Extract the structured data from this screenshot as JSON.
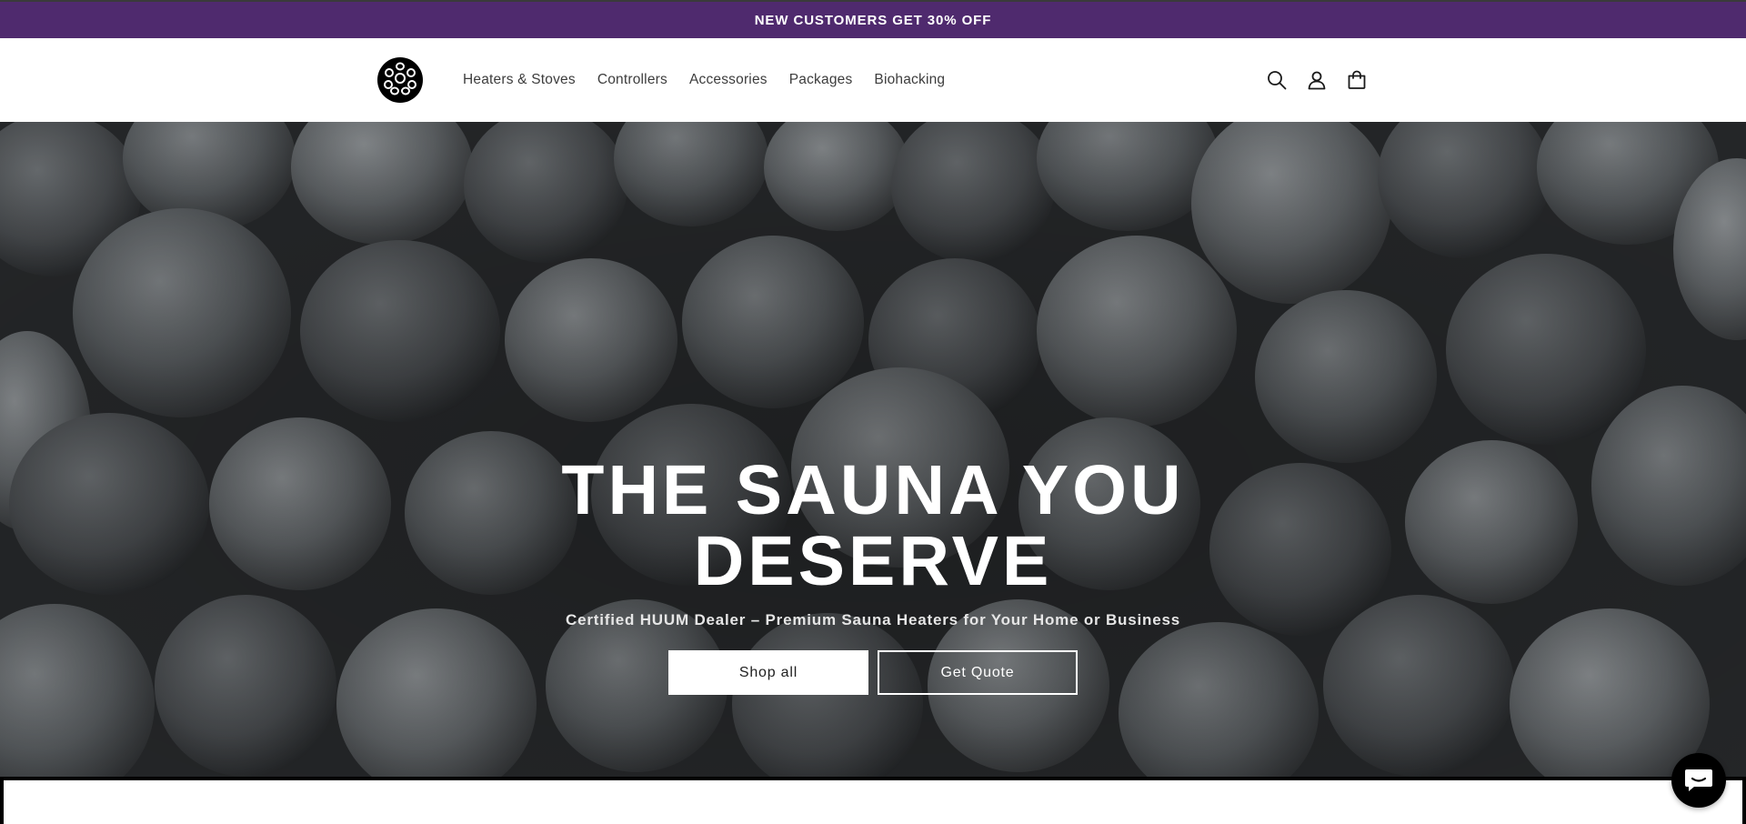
{
  "announcement": {
    "text": "NEW CUSTOMERS GET 30% OFF",
    "background": "#4f2a6e"
  },
  "header": {
    "logo_icon": "cluster-of-stones-logo",
    "nav": [
      {
        "label": "Heaters & Stoves"
      },
      {
        "label": "Controllers"
      },
      {
        "label": "Accessories"
      },
      {
        "label": "Packages"
      },
      {
        "label": "Biohacking"
      }
    ],
    "icons": [
      "search-icon",
      "account-icon",
      "cart-icon"
    ]
  },
  "hero": {
    "title_line1": "THE SAUNA YOU",
    "title_line2": "DESERVE",
    "subtitle": "Certified HUUM Dealer – Premium Sauna Heaters for Your Home or Business",
    "primary_button": "Shop all",
    "secondary_button": "Get Quote",
    "background_image": "dark sauna stones"
  },
  "chat": {
    "icon": "chat-bubble-icon"
  }
}
